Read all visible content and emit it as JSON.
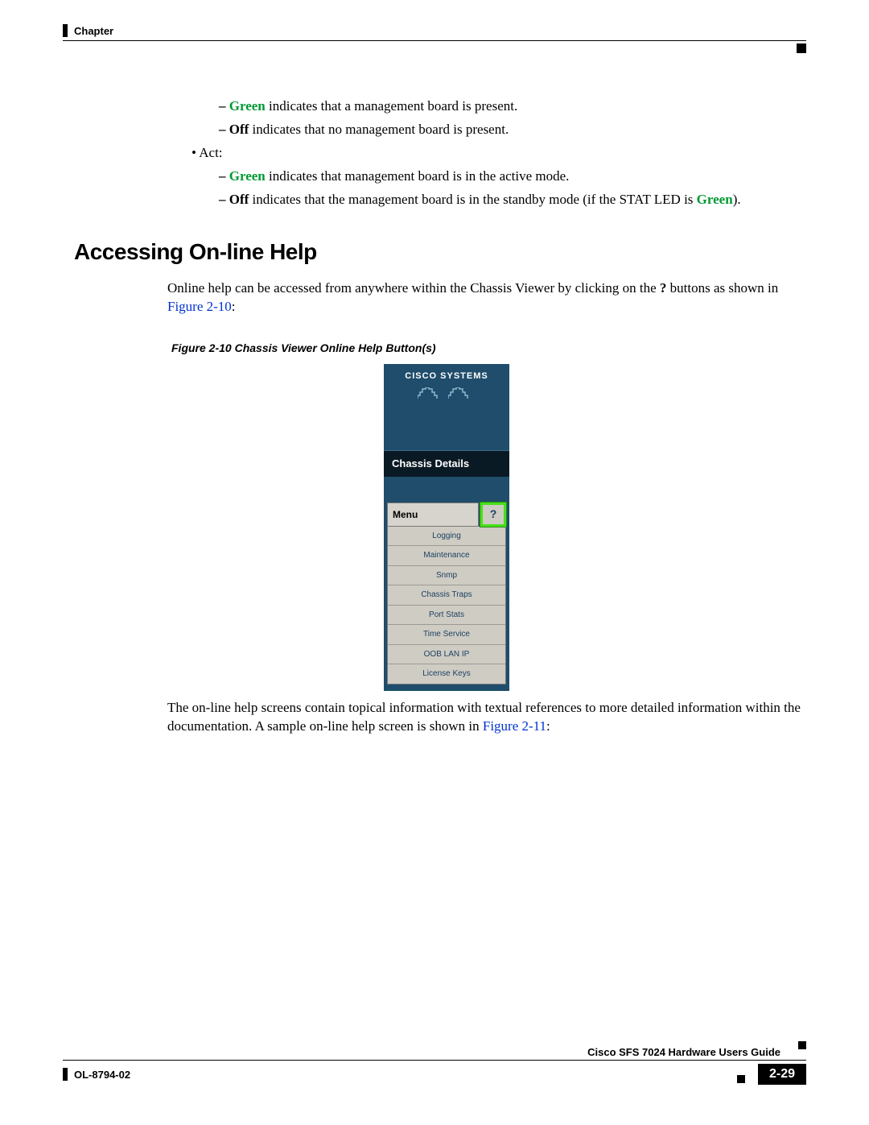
{
  "header": {
    "chapter": "Chapter"
  },
  "bullets": {
    "green_present": "Green",
    "green_present_rest": " indicates that a management board is present.",
    "off_label": "Off",
    "off_rest": " indicates that no management board is present.",
    "act_label": "Act:",
    "green_active": "Green",
    "green_active_rest": " indicates that management board is in the active mode.",
    "off2_label": "Off",
    "off2_rest_a": " indicates that the management board is in the standby mode (if the STAT LED is ",
    "off2_green": "Green",
    "off2_rest_b": ")."
  },
  "section": {
    "title": "Accessing On-line Help",
    "para1_a": "Online help can be accessed from anywhere within the Chassis Viewer by clicking on the ",
    "para1_q": "?",
    "para1_b": " buttons as shown in ",
    "para1_link": "Figure 2-10",
    "para1_c": ":",
    "fig_caption": "Figure 2-10   Chassis Viewer Online Help Button(s)",
    "para2_a": "The on-line help screens contain topical information with textual references to more detailed information within the documentation. A sample on-line help screen is shown in ",
    "para2_link": "Figure 2-11",
    "para2_b": ":"
  },
  "screenshot": {
    "brand": "CISCO SYSTEMS",
    "chassis": "Chassis Details",
    "menu": "Menu",
    "help_glyph": "?",
    "items": [
      "Logging",
      "Maintenance",
      "Snmp",
      "Chassis Traps",
      "Port Stats",
      "Time Service",
      "OOB LAN IP",
      "License Keys"
    ]
  },
  "footer": {
    "guide": "Cisco SFS 7024 Hardware Users Guide",
    "ol": "OL-8794-02",
    "pagenum": "2-29"
  }
}
